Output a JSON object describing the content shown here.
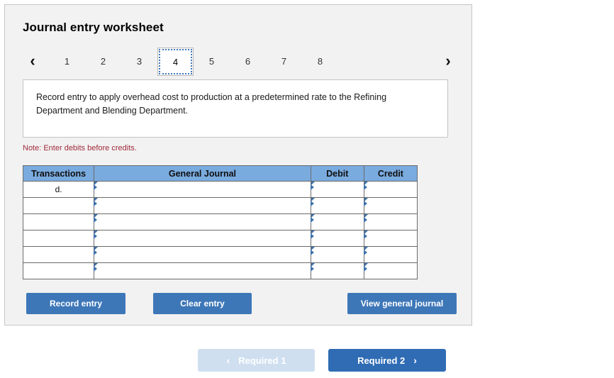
{
  "panel": {
    "title": "Journal entry worksheet"
  },
  "pager": {
    "prev_icon": "chevron-left-icon",
    "prev_glyph": "‹",
    "next_icon": "chevron-right-icon",
    "next_glyph": "›",
    "tabs": [
      {
        "label": "1",
        "active": false
      },
      {
        "label": "2",
        "active": false
      },
      {
        "label": "3",
        "active": false
      },
      {
        "label": "4",
        "active": true
      },
      {
        "label": "5",
        "active": false
      },
      {
        "label": "6",
        "active": false
      },
      {
        "label": "7",
        "active": false
      },
      {
        "label": "8",
        "active": false
      }
    ],
    "active_tab": "4"
  },
  "prompt": {
    "text": "Record entry to apply overhead cost to production at a predetermined rate to the Refining Department and Blending Department."
  },
  "note": {
    "text": "Note: Enter debits before credits."
  },
  "journal": {
    "columns": [
      "Transactions",
      "General Journal",
      "Debit",
      "Credit"
    ],
    "rows": [
      {
        "transaction": "d.",
        "general_journal": "",
        "debit": "",
        "credit": ""
      },
      {
        "transaction": "",
        "general_journal": "",
        "debit": "",
        "credit": ""
      },
      {
        "transaction": "",
        "general_journal": "",
        "debit": "",
        "credit": ""
      },
      {
        "transaction": "",
        "general_journal": "",
        "debit": "",
        "credit": ""
      },
      {
        "transaction": "",
        "general_journal": "",
        "debit": "",
        "credit": ""
      },
      {
        "transaction": "",
        "general_journal": "",
        "debit": "",
        "credit": ""
      }
    ]
  },
  "actions": {
    "record_entry": "Record entry",
    "clear_entry": "Clear entry",
    "view_general_journal": "View general journal"
  },
  "bottom_nav": {
    "prev_label": "Required 1",
    "prev_icon": "chevron-left-icon",
    "prev_glyph": "‹",
    "prev_disabled": true,
    "next_label": "Required 2",
    "next_icon": "chevron-right-icon",
    "next_glyph": "›",
    "next_disabled": false
  },
  "colors": {
    "panel_background": "#f2f2f2",
    "panel_border": "#c6c6c6",
    "table_header_blue": "#7aabdf",
    "input_border_blue": "#4c7fb5",
    "button_blue": "#3d77b8",
    "nav_active_blue": "#2f6cb4",
    "nav_disabled_blue": "#cfdff0",
    "note_red": "#a02b3c"
  }
}
